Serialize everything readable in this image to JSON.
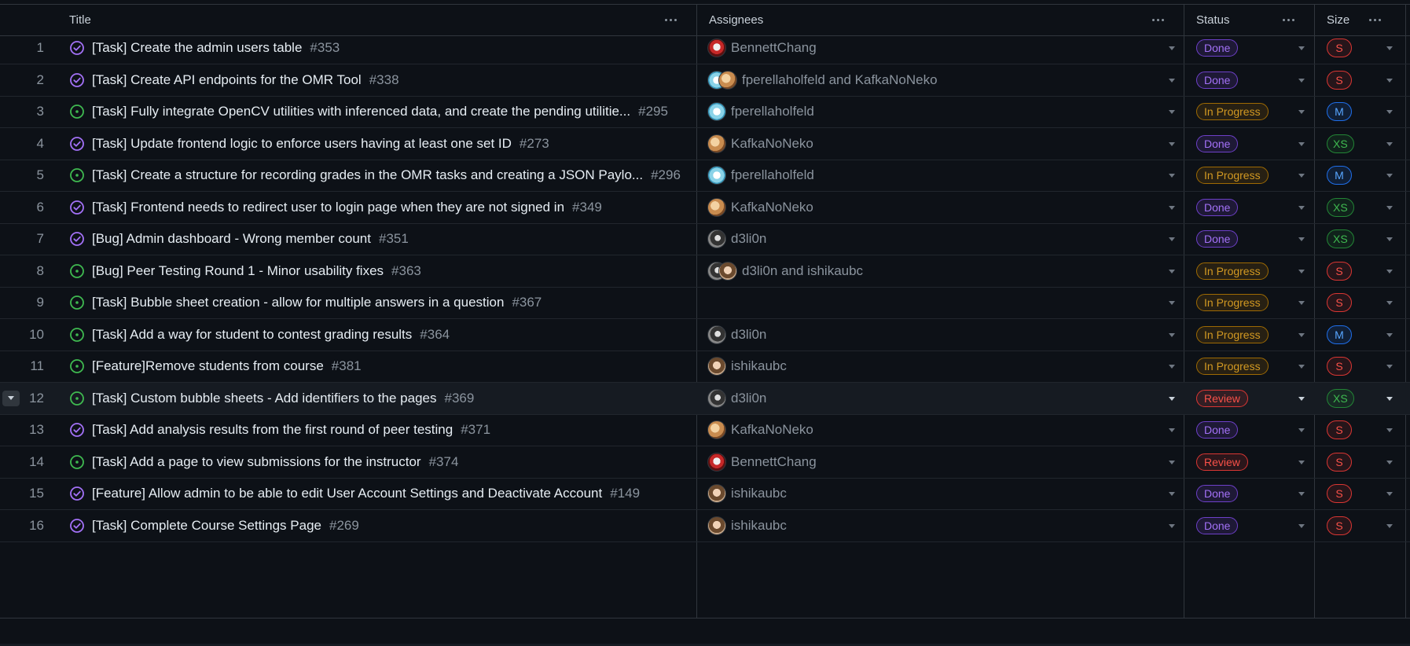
{
  "columns": {
    "title": "Title",
    "assignees": "Assignees",
    "status": "Status",
    "size": "Size"
  },
  "status_colors": {
    "Done": {
      "text": "#a371f7",
      "border": "#6e40c9",
      "bg": "rgba(110,64,201,0.18)"
    },
    "In Progress": {
      "text": "#d29922",
      "border": "#9e6a03",
      "bg": "rgba(158,106,3,0.18)"
    },
    "Review": {
      "text": "#f85149",
      "border": "#da3633",
      "bg": "rgba(218,54,51,0.15)"
    }
  },
  "size_colors": {
    "S": {
      "text": "#f85149",
      "border": "#da3633",
      "bg": "rgba(218,54,51,0.12)"
    },
    "M": {
      "text": "#58a6ff",
      "border": "#1f6feb",
      "bg": "rgba(31,111,235,0.15)"
    },
    "XS": {
      "text": "#3fb950",
      "border": "#238636",
      "bg": "rgba(35,134,54,0.15)"
    }
  },
  "rows": [
    {
      "num": "1",
      "state": "closed",
      "title": "[Task] Create the admin users table",
      "issue": "#353",
      "assignee_text": "BennettChang",
      "avatars": [
        "bennett"
      ],
      "status": "Done",
      "size": "S"
    },
    {
      "num": "2",
      "state": "closed",
      "title": "[Task] Create API endpoints for the OMR Tool",
      "issue": "#338",
      "assignee_text": "fperellaholfeld and KafkaNoNeko",
      "avatars": [
        "fperella",
        "kafka"
      ],
      "status": "Done",
      "size": "S"
    },
    {
      "num": "3",
      "state": "open",
      "title": "[Task] Fully integrate OpenCV utilities with inferenced data, and create the pending utilitie...",
      "issue": "#295",
      "assignee_text": "fperellaholfeld",
      "avatars": [
        "fperella"
      ],
      "status": "In Progress",
      "size": "M"
    },
    {
      "num": "4",
      "state": "closed",
      "title": "[Task] Update frontend logic to enforce users having at least one set ID",
      "issue": "#273",
      "assignee_text": "KafkaNoNeko",
      "avatars": [
        "kafka"
      ],
      "status": "Done",
      "size": "XS"
    },
    {
      "num": "5",
      "state": "open",
      "title": "[Task] Create a structure for recording grades in the OMR tasks and creating a JSON Paylo...",
      "issue": "#296",
      "assignee_text": "fperellaholfeld",
      "avatars": [
        "fperella"
      ],
      "status": "In Progress",
      "size": "M"
    },
    {
      "num": "6",
      "state": "closed",
      "title": "[Task] Frontend needs to redirect user to login page when they are not signed in",
      "issue": "#349",
      "assignee_text": "KafkaNoNeko",
      "avatars": [
        "kafka"
      ],
      "status": "Done",
      "size": "XS"
    },
    {
      "num": "7",
      "state": "closed",
      "title": "[Bug] Admin dashboard - Wrong member count",
      "issue": "#351",
      "assignee_text": "d3li0n",
      "avatars": [
        "d3li0n"
      ],
      "status": "Done",
      "size": "XS"
    },
    {
      "num": "8",
      "state": "open",
      "title": "[Bug] Peer Testing Round 1 - Minor usability fixes",
      "issue": "#363",
      "assignee_text": "d3li0n and ishikaubc",
      "avatars": [
        "d3li0n",
        "ishika"
      ],
      "status": "In Progress",
      "size": "S"
    },
    {
      "num": "9",
      "state": "open",
      "title": "[Task] Bubble sheet creation - allow for multiple answers in a question",
      "issue": "#367",
      "assignee_text": "",
      "avatars": [],
      "status": "In Progress",
      "size": "S"
    },
    {
      "num": "10",
      "state": "open",
      "title": "[Task] Add a way for student to contest grading results",
      "issue": "#364",
      "assignee_text": "d3li0n",
      "avatars": [
        "d3li0n"
      ],
      "status": "In Progress",
      "size": "M"
    },
    {
      "num": "11",
      "state": "open",
      "title": "[Feature]Remove students from course",
      "issue": "#381",
      "assignee_text": "ishikaubc",
      "avatars": [
        "ishika"
      ],
      "status": "In Progress",
      "size": "S"
    },
    {
      "num": "12",
      "state": "open",
      "title": "[Task] Custom bubble sheets - Add identifiers to the pages",
      "issue": "#369",
      "assignee_text": "d3li0n",
      "avatars": [
        "d3li0n"
      ],
      "status": "Review",
      "size": "XS",
      "hover": true
    },
    {
      "num": "13",
      "state": "closed",
      "title": "[Task] Add analysis results from the first round of peer testing",
      "issue": "#371",
      "assignee_text": "KafkaNoNeko",
      "avatars": [
        "kafka"
      ],
      "status": "Done",
      "size": "S"
    },
    {
      "num": "14",
      "state": "open",
      "title": "[Task] Add a page to view submissions for the instructor",
      "issue": "#374",
      "assignee_text": "BennettChang",
      "avatars": [
        "bennett"
      ],
      "status": "Review",
      "size": "S"
    },
    {
      "num": "15",
      "state": "closed",
      "title": "[Feature] Allow admin to be able to edit User Account Settings and Deactivate Account",
      "issue": "#149",
      "assignee_text": "ishikaubc",
      "avatars": [
        "ishika"
      ],
      "status": "Done",
      "size": "S"
    },
    {
      "num": "16",
      "state": "closed",
      "title": "[Task] Complete Course Settings Page",
      "issue": "#269",
      "assignee_text": "ishikaubc",
      "avatars": [
        "ishika"
      ],
      "status": "Done",
      "size": "S"
    }
  ]
}
